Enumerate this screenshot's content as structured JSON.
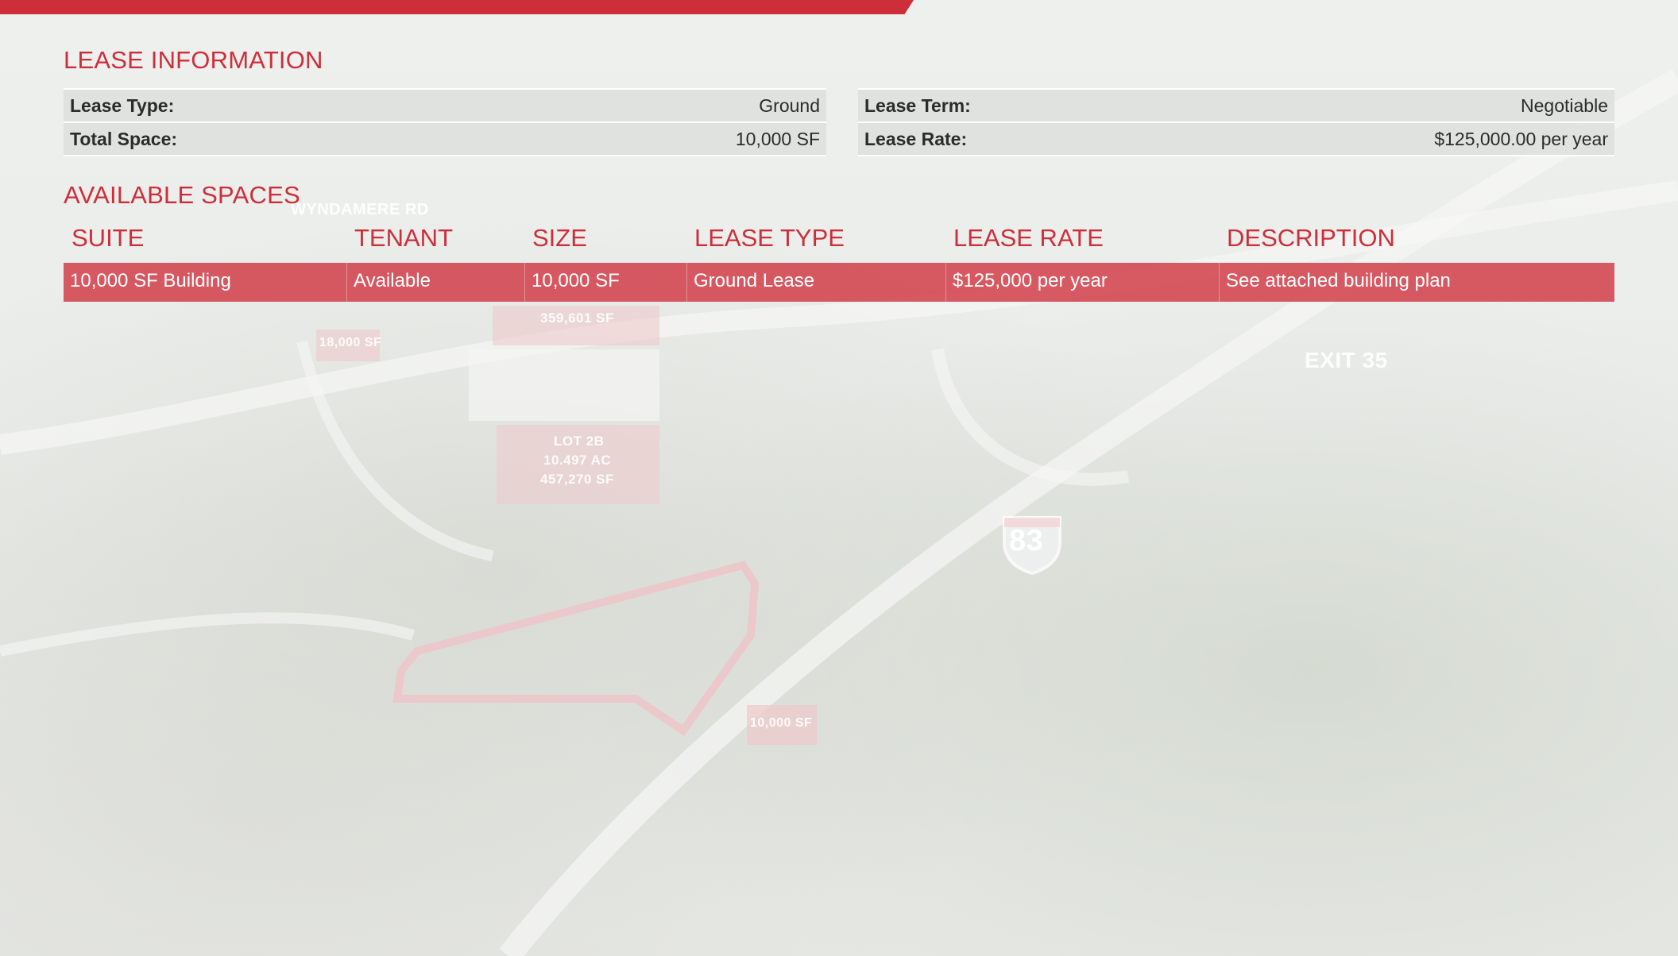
{
  "lease_information": {
    "title": "LEASE INFORMATION",
    "left": [
      {
        "label": "Lease Type:",
        "value": "Ground"
      },
      {
        "label": "Total Space:",
        "value": "10,000 SF"
      }
    ],
    "right": [
      {
        "label": "Lease Term:",
        "value": "Negotiable"
      },
      {
        "label": "Lease Rate:",
        "value": "$125,000.00 per year"
      }
    ]
  },
  "available_spaces": {
    "title": "AVAILABLE SPACES",
    "headers": [
      "SUITE",
      "TENANT",
      "SIZE",
      "LEASE TYPE",
      "LEASE RATE",
      "DESCRIPTION"
    ],
    "rows": [
      [
        "10,000 SF Building",
        "Available",
        "10,000 SF",
        "Ground Lease",
        "$125,000 per year",
        "See attached building plan"
      ]
    ]
  },
  "map_labels": {
    "road": "WYNDAMERE RD",
    "lot_a_size": "359,601 SF",
    "lot_b_size": "18,000 SF",
    "lot_c": "LOT 2B",
    "lot_c_acres": "10.497 AC",
    "lot_c_size": "457,270 SF",
    "exit": "EXIT 35",
    "interstate": "83",
    "building_size": "10,000 SF"
  },
  "colors": {
    "accent": "#cc2f3a",
    "row_fill": "#d23f4a",
    "background": "#eceeec"
  }
}
